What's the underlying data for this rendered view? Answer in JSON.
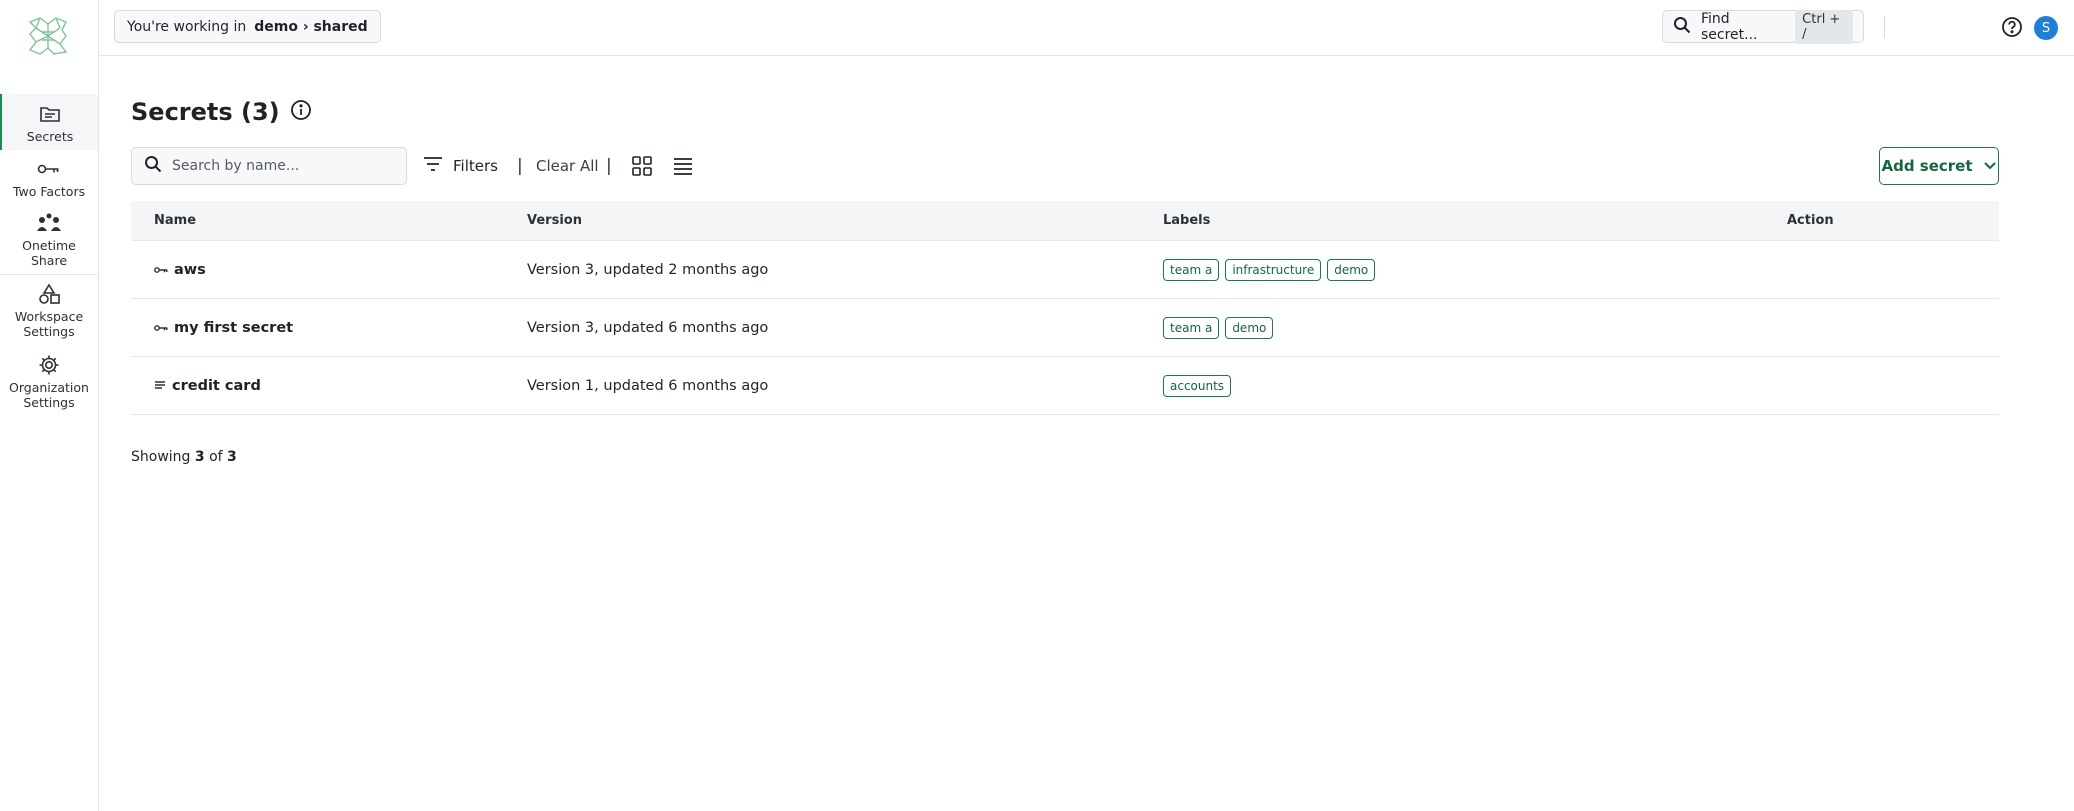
{
  "sidebar": {
    "items": [
      {
        "label": "Secrets",
        "icon": "folder-icon"
      },
      {
        "label": "Two Factors",
        "icon": "key-icon"
      },
      {
        "label": "Onetime Share",
        "icon": "share-icon"
      },
      {
        "label": "Workspace Settings",
        "icon": "shapes-icon"
      },
      {
        "label": "Organization Settings",
        "icon": "gear-icon"
      }
    ]
  },
  "header": {
    "context_prefix": "You're working in",
    "context_path": "demo › shared",
    "find_label": "Find secret...",
    "find_shortcut": "Ctrl + /",
    "avatar_initial": "S"
  },
  "main": {
    "title": "Secrets (3)",
    "search_placeholder": "Search by name...",
    "filters_label": "Filters",
    "separator": "|",
    "clear_label": "Clear All",
    "add_label": "Add secret",
    "columns": [
      "Name",
      "Version",
      "Labels",
      "Action"
    ],
    "rows": [
      {
        "name": "aws",
        "type_icon": "key-icon",
        "version": "Version 3, updated 2 months ago",
        "labels": [
          "team a",
          "infrastructure",
          "demo"
        ]
      },
      {
        "name": "my first secret",
        "type_icon": "key-icon",
        "version": "Version 3, updated 6 months ago",
        "labels": [
          "team a",
          "demo"
        ]
      },
      {
        "name": "credit card",
        "type_icon": "lines-icon",
        "version": "Version 1, updated 6 months ago",
        "labels": [
          "accounts"
        ]
      }
    ],
    "showing": {
      "prefix": "Showing",
      "count": "3",
      "of": "of",
      "total": "3"
    }
  },
  "colors": {
    "accent": "#1d7a4f",
    "avatar": "#1d7fd6"
  }
}
